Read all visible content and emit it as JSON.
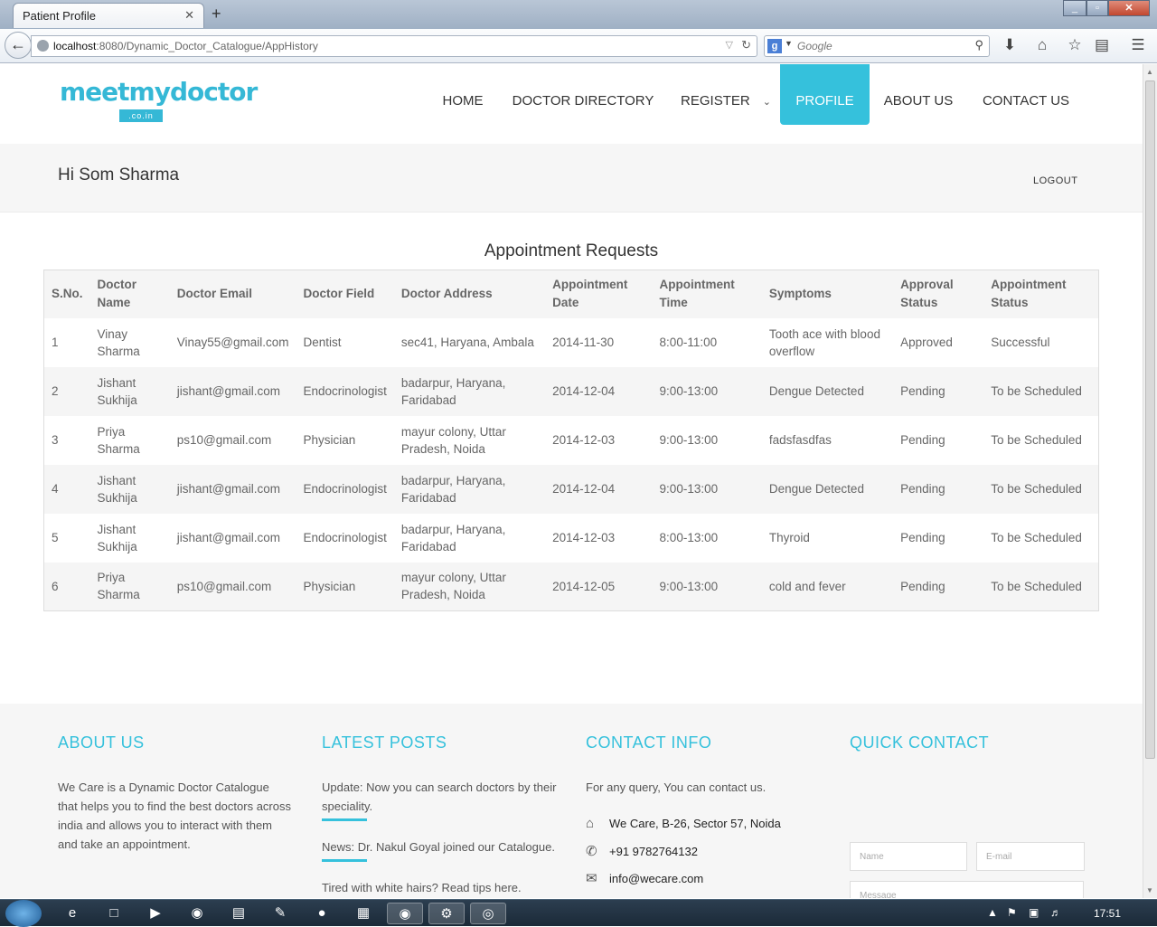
{
  "browser": {
    "tab_title": "Patient Profile",
    "tab_close": "✕",
    "new_tab": "+",
    "url_host": "localhost",
    "url_rest": ":8080/Dynamic_Doctor_Catalogue/AppHistory",
    "search_engine": "Google",
    "window_min": "_",
    "window_max": "▫",
    "window_close": "✕"
  },
  "site": {
    "logo_text": "meetmydoctor",
    "logo_tag": ".co.in",
    "nav": {
      "home": "HOME",
      "directory": "DOCTOR DIRECTORY",
      "register": "REGISTER",
      "profile": "PROFILE",
      "about": "ABOUT US",
      "contact": "CONTACT US"
    },
    "accent": "#35c1dc"
  },
  "user": {
    "greeting": "Hi Som Sharma",
    "logout": "LOGOUT"
  },
  "appointments": {
    "title": "Appointment Requests",
    "headers": {
      "sno": "S.No.",
      "name": "Doctor Name",
      "email": "Doctor Email",
      "field": "Doctor Field",
      "address": "Doctor Address",
      "date": "Appointment Date",
      "time": "Appointment Time",
      "symptoms": "Symptoms",
      "approval": "Approval Status",
      "status": "Appointment Status"
    },
    "rows": [
      {
        "sno": "1",
        "name": "Vinay Sharma",
        "email": "Vinay55@gmail.com",
        "field": "Dentist",
        "address": "sec41, Haryana, Ambala",
        "date": "2014-11-30",
        "time": "8:00-11:00",
        "symptoms": "Tooth ace with blood overflow",
        "approval": "Approved",
        "status": "Successful"
      },
      {
        "sno": "2",
        "name": "Jishant Sukhija",
        "email": "jishant@gmail.com",
        "field": "Endocrinologist",
        "address": "badarpur, Haryana, Faridabad",
        "date": "2014-12-04",
        "time": "9:00-13:00",
        "symptoms": "Dengue Detected",
        "approval": "Pending",
        "status": "To be Scheduled"
      },
      {
        "sno": "3",
        "name": "Priya Sharma",
        "email": "ps10@gmail.com",
        "field": "Physician",
        "address": "mayur colony, Uttar Pradesh, Noida",
        "date": "2014-12-03",
        "time": "9:00-13:00",
        "symptoms": "fadsfasdfas",
        "approval": "Pending",
        "status": "To be Scheduled"
      },
      {
        "sno": "4",
        "name": "Jishant Sukhija",
        "email": "jishant@gmail.com",
        "field": "Endocrinologist",
        "address": "badarpur, Haryana, Faridabad",
        "date": "2014-12-04",
        "time": "9:00-13:00",
        "symptoms": "Dengue Detected",
        "approval": "Pending",
        "status": "To be Scheduled"
      },
      {
        "sno": "5",
        "name": "Jishant Sukhija",
        "email": "jishant@gmail.com",
        "field": "Endocrinologist",
        "address": "badarpur, Haryana, Faridabad",
        "date": "2014-12-03",
        "time": "8:00-13:00",
        "symptoms": "Thyroid",
        "approval": "Pending",
        "status": "To be Scheduled"
      },
      {
        "sno": "6",
        "name": "Priya Sharma",
        "email": "ps10@gmail.com",
        "field": "Physician",
        "address": "mayur colony, Uttar Pradesh, Noida",
        "date": "2014-12-05",
        "time": "9:00-13:00",
        "symptoms": "cold and fever",
        "approval": "Pending",
        "status": "To be Scheduled"
      }
    ]
  },
  "footer": {
    "about_title": "ABOUT US",
    "about_text": "We Care is a Dynamic Doctor Catalogue that helps you to find the best doctors across india and allows you to interact with them and take an appointment.",
    "posts_title": "LATEST POSTS",
    "post1": "Update: Now you can search doctors by their speciality.",
    "post2": "News: Dr. Nakul Goyal joined our Catalogue.",
    "post3": "Tired with white hairs? Read tips here.",
    "contact_title": "CONTACT INFO",
    "contact_intro": "For any query, You can contact us.",
    "address": "We Care, B-26, Sector 57, Noida",
    "phone": "+91 9782764132",
    "email": "info@wecare.com",
    "quick_title": "QUICK CONTACT",
    "name_placeholder": "Name",
    "email_placeholder": "E-mail",
    "message_placeholder": "Message"
  },
  "taskbar": {
    "clock": "17:51"
  }
}
